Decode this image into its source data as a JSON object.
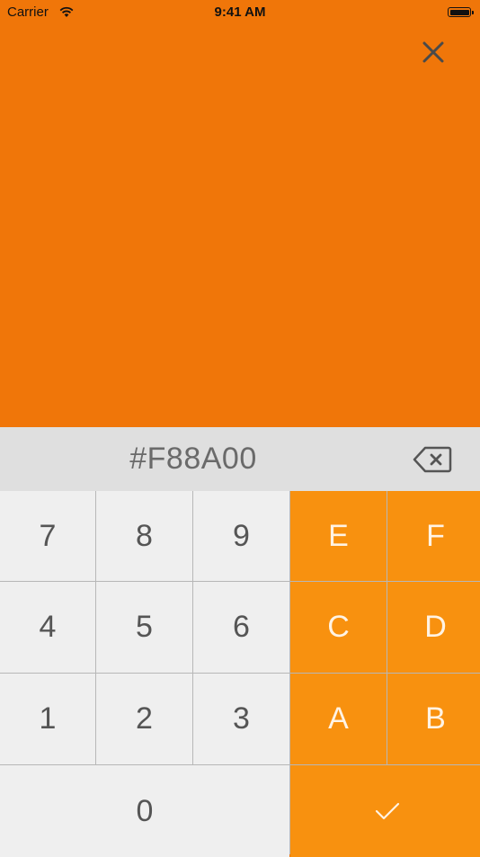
{
  "status_bar": {
    "carrier": "Carrier",
    "time": "9:41 AM"
  },
  "color_preview": {
    "color": "#F07609"
  },
  "hex_input": {
    "value": "#F88A00"
  },
  "keypad": {
    "rows": [
      [
        "7",
        "8",
        "9",
        "E",
        "F"
      ],
      [
        "4",
        "5",
        "6",
        "C",
        "D"
      ],
      [
        "1",
        "2",
        "3",
        "A",
        "B"
      ]
    ],
    "zero_label": "0"
  },
  "colors": {
    "preview": "#F07609",
    "hex_key": "#F8910F",
    "number_key": "#EFEFEF",
    "hex_bar": "#DFDFDF"
  },
  "icons": {
    "close": "close-icon",
    "backspace": "backspace-icon",
    "confirm": "checkmark-icon"
  }
}
